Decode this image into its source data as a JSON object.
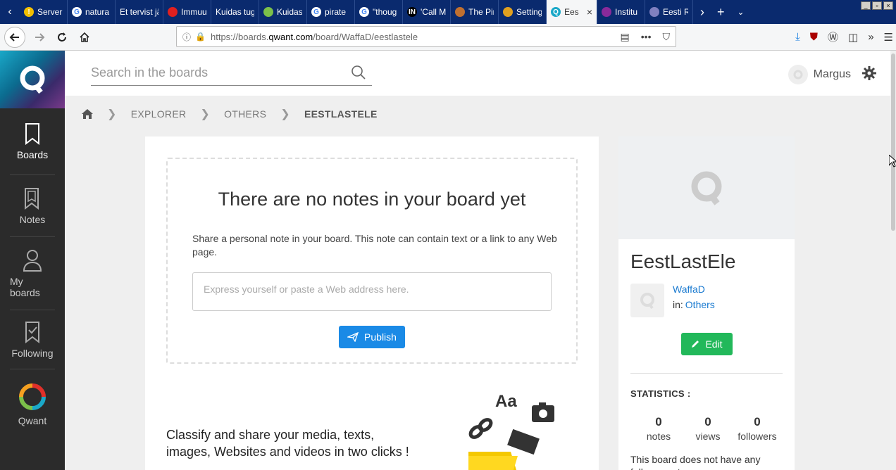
{
  "browser": {
    "tabs": [
      {
        "label": "Server",
        "fav_color": "#f4c000",
        "fav_glyph": "!"
      },
      {
        "label": "natura",
        "fav_color": "#ffffff",
        "fav_glyph": "G"
      },
      {
        "label": "Et tervist jä",
        "fav_color": "",
        "fav_glyph": ""
      },
      {
        "label": "Immuu",
        "fav_color": "#e02020",
        "fav_glyph": ""
      },
      {
        "label": "Kuidas tuge",
        "fav_color": "",
        "fav_glyph": ""
      },
      {
        "label": "Kuidas",
        "fav_color": "#7cc04a",
        "fav_glyph": ""
      },
      {
        "label": "pirate",
        "fav_color": "#ffffff",
        "fav_glyph": "G"
      },
      {
        "label": "\"thoug",
        "fav_color": "#ffffff",
        "fav_glyph": "G"
      },
      {
        "label": "'Call Me",
        "fav_color": "#000000",
        "fav_glyph": "IN"
      },
      {
        "label": "The Pir",
        "fav_color": "#c07030",
        "fav_glyph": ""
      },
      {
        "label": "Setting",
        "fav_color": "#e0a020",
        "fav_glyph": ""
      },
      {
        "label": "Ees",
        "fav_color": "#1aa8c8",
        "fav_glyph": "Q",
        "active": true
      },
      {
        "label": "Institu",
        "fav_color": "#8a2a9a",
        "fav_glyph": ""
      },
      {
        "label": "Eesti R",
        "fav_color": "#8080c0",
        "fav_glyph": ""
      }
    ],
    "url_prefix": "https://boards.",
    "url_domain": "qwant.com",
    "url_path": "/board/WaffaD/eestlastele"
  },
  "rail": {
    "items": [
      {
        "label": "Boards"
      },
      {
        "label": "Notes"
      },
      {
        "label": "My boards"
      },
      {
        "label": "Following"
      },
      {
        "label": "Qwant"
      }
    ]
  },
  "header": {
    "search_placeholder": "Search in the boards",
    "user_name": "Margus"
  },
  "breadcrumb": {
    "explorer": "EXPLORER",
    "others": "OTHERS",
    "current": "EESTLASTELE"
  },
  "main": {
    "empty_title": "There are no notes in your board yet",
    "empty_desc": "Share a personal note in your board. This note can contain text or a link to any Web page.",
    "note_placeholder": "Express yourself or paste a Web address here.",
    "publish_label": "Publish",
    "promo_text": "Classify and share your media, texts, images, Websites and videos in two clicks !",
    "illus_text": "Aa"
  },
  "side": {
    "board_name": "EestLastEle",
    "owner": "WaffaD",
    "in_label": "in:",
    "category": "Others",
    "edit_label": "Edit",
    "stats_title": "STATISTICS :",
    "stats": [
      {
        "value": "0",
        "label": "notes"
      },
      {
        "value": "0",
        "label": "views"
      },
      {
        "value": "0",
        "label": "followers"
      }
    ],
    "no_followers": "This board does not have any follower yet."
  },
  "colors": {
    "rail_bg": "#2b2b2b",
    "publish": "#1a8ae6",
    "edit": "#22b85a",
    "link": "#1a7ad0"
  }
}
